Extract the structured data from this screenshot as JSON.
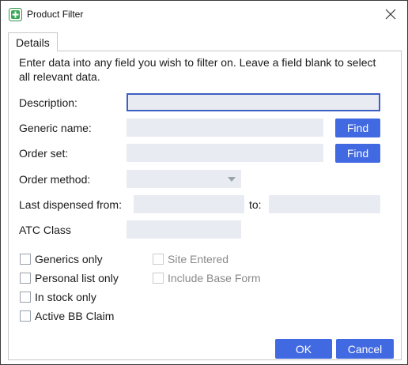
{
  "window": {
    "title": "Product Filter",
    "app_icon": "product-filter-app-icon",
    "close_icon": "close-icon"
  },
  "tab": {
    "label": "Details"
  },
  "intro": "Enter data into any field you wish to filter on. Leave a field blank to select all relevant data.",
  "fields": {
    "description_label": "Description:",
    "generic_name_label": "Generic name:",
    "order_set_label": "Order set:",
    "order_method_label": "Order method:",
    "last_dispensed_from_label": "Last dispensed from:",
    "to_label": "to:",
    "atc_class_label": "ATC Class",
    "description_value": "",
    "generic_name_value": "",
    "order_set_value": "",
    "order_method_value": "",
    "last_dispensed_from_value": "",
    "last_dispensed_to_value": "",
    "atc_class_value": ""
  },
  "buttons": {
    "find_generic": "Find",
    "find_order_set": "Find",
    "ok": "OK",
    "cancel": "Cancel"
  },
  "checkboxes": {
    "generics_only": {
      "label": "Generics only",
      "checked": false,
      "enabled": true
    },
    "personal_list_only": {
      "label": "Personal list only",
      "checked": false,
      "enabled": true
    },
    "in_stock_only": {
      "label": "In stock only",
      "checked": false,
      "enabled": true
    },
    "active_bb_claim": {
      "label": "Active BB Claim",
      "checked": false,
      "enabled": true
    },
    "site_entered": {
      "label": "Site Entered",
      "checked": false,
      "enabled": false
    },
    "include_base_form": {
      "label": "Include Base Form",
      "checked": false,
      "enabled": false
    }
  },
  "colors": {
    "accent": "#4169e1",
    "field_bg": "#e8ecf2",
    "focus_border": "#3d5fc4"
  }
}
